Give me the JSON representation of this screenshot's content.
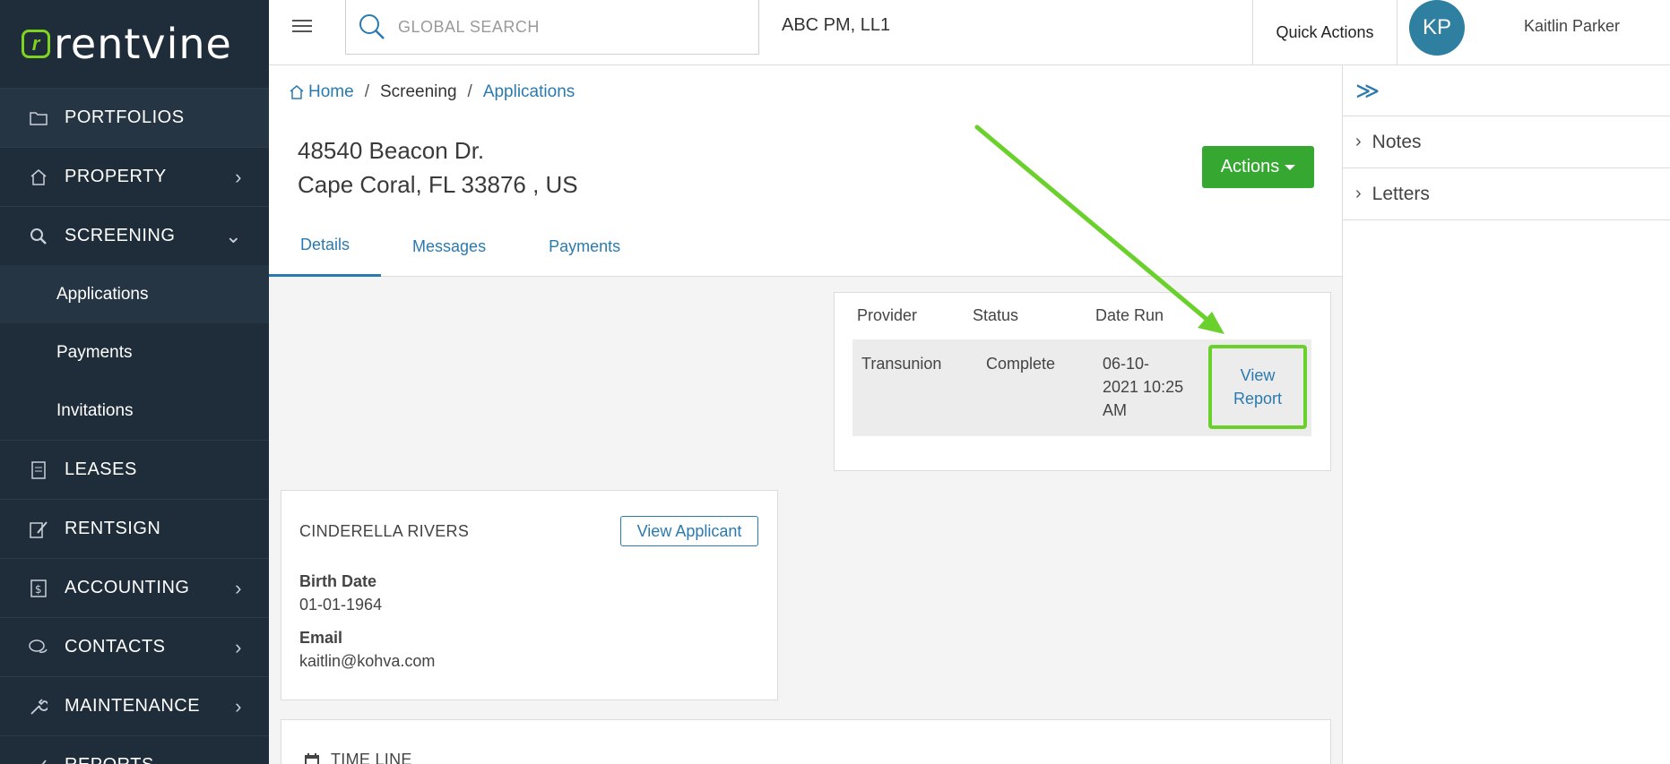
{
  "brand": {
    "logo_text": "rentvine",
    "accent": "#7ed321"
  },
  "sidebar": {
    "items": [
      {
        "label": "PORTFOLIOS",
        "icon": "folder-icon",
        "chevron": ""
      },
      {
        "label": "PROPERTY",
        "icon": "home-icon",
        "chevron": "›"
      },
      {
        "label": "SCREENING",
        "icon": "search-icon",
        "chevron": "⌄"
      },
      {
        "label": "LEASES",
        "icon": "document-icon",
        "chevron": ""
      },
      {
        "label": "RENTSIGN",
        "icon": "signature-icon",
        "chevron": ""
      },
      {
        "label": "ACCOUNTING",
        "icon": "dollar-icon",
        "chevron": "›"
      },
      {
        "label": "CONTACTS",
        "icon": "chat-icon",
        "chevron": "›"
      },
      {
        "label": "MAINTENANCE",
        "icon": "wrench-icon",
        "chevron": "›"
      },
      {
        "label": "REPORTS",
        "icon": "chart-icon",
        "chevron": ""
      }
    ],
    "screening_sub": [
      "Applications",
      "Payments",
      "Invitations"
    ]
  },
  "topbar": {
    "search_placeholder": "GLOBAL SEARCH",
    "company": "ABC PM, LL1",
    "quick_actions": "Quick Actions",
    "avatar_initials": "KP",
    "user_name": "Kaitlin Parker"
  },
  "breadcrumb": {
    "home": "Home",
    "screening": "Screening",
    "applications": "Applications"
  },
  "property": {
    "line1": "48540 Beacon Dr.",
    "line2": "Cape Coral, FL 33876 , US"
  },
  "actions_label": "Actions",
  "tabs": [
    "Details",
    "Messages",
    "Payments"
  ],
  "report": {
    "headers": [
      "Provider",
      "Status",
      "Date Run"
    ],
    "row": {
      "provider": "Transunion",
      "status": "Complete",
      "date_line1": "06-10-",
      "date_line2": "2021 10:25",
      "date_line3": "AM",
      "view_line1": "View",
      "view_line2": "Report"
    }
  },
  "applicant": {
    "name": "CINDERELLA RIVERS",
    "view_button": "View Applicant",
    "birth_label": "Birth Date",
    "birth_value": "01-01-1964",
    "email_label": "Email",
    "email_value": "kaitlin@kohva.com"
  },
  "timeline": {
    "title": "TIME LINE"
  },
  "right_panel": {
    "collapse": "≫",
    "items": [
      "Notes",
      "Letters"
    ]
  },
  "colors": {
    "sidebar": "#1f2d3a",
    "link": "#2a7ab0",
    "actions": "#36a832",
    "highlight": "#6ad12c"
  }
}
